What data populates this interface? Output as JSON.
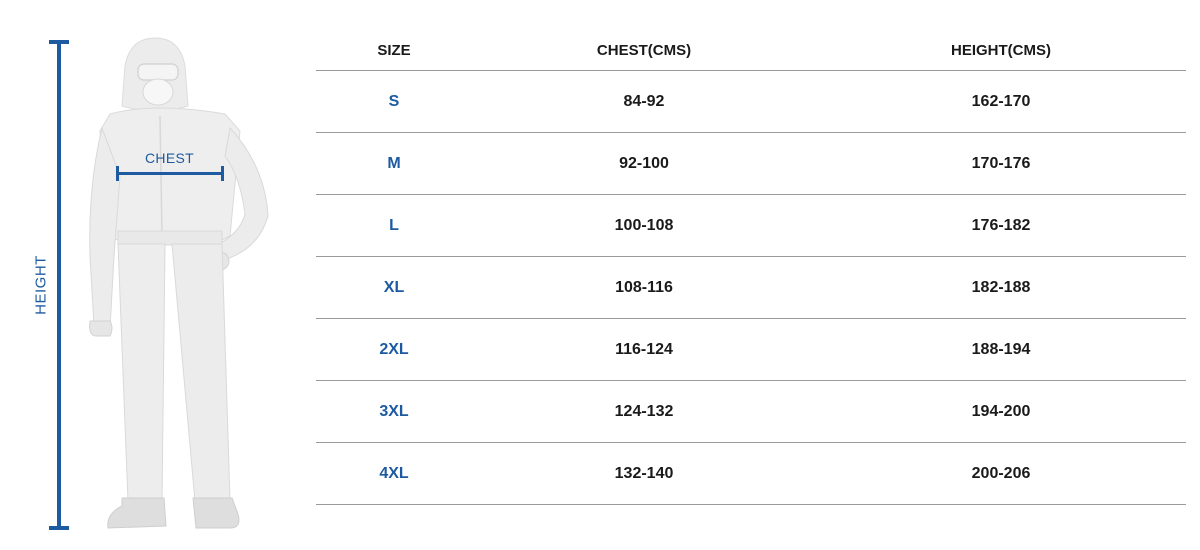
{
  "figure": {
    "height_label": "HEIGHT",
    "chest_label": "CHEST",
    "accent_color": "#1d5aa0",
    "illustration": "protective-coverall-figure"
  },
  "table": {
    "headers": {
      "size": "SIZE",
      "chest": "CHEST(CMS)",
      "height": "HEIGHT(CMS)"
    },
    "rows": [
      {
        "size": "S",
        "chest": "84-92",
        "height": "162-170"
      },
      {
        "size": "M",
        "chest": "92-100",
        "height": "170-176"
      },
      {
        "size": "L",
        "chest": "100-108",
        "height": "176-182"
      },
      {
        "size": "XL",
        "chest": "108-116",
        "height": "182-188"
      },
      {
        "size": "2XL",
        "chest": "116-124",
        "height": "188-194"
      },
      {
        "size": "3XL",
        "chest": "124-132",
        "height": "194-200"
      },
      {
        "size": "4XL",
        "chest": "132-140",
        "height": "200-206"
      }
    ]
  }
}
